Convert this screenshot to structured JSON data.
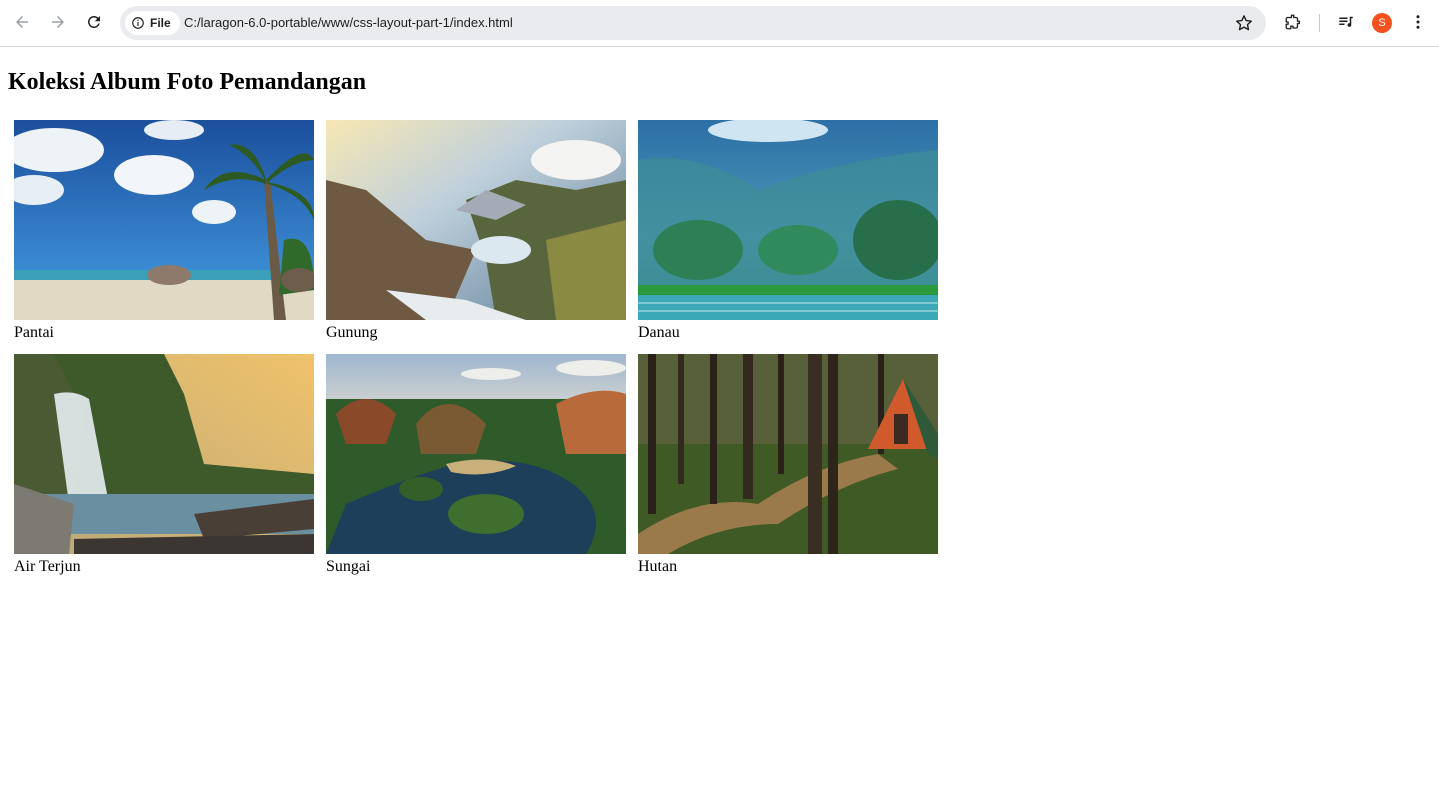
{
  "browser": {
    "security_chip": "File",
    "url": "C:/laragon-6.0-portable/www/css-layout-part-1/index.html",
    "profile_initial": "S",
    "icons": [
      "back-icon",
      "forward-icon",
      "reload-icon",
      "info-icon",
      "star-icon",
      "extensions-icon",
      "media-control-icon",
      "menu-dots-icon"
    ]
  },
  "page": {
    "title": "Koleksi Album Foto Pemandangan",
    "gallery": [
      {
        "caption": "Pantai"
      },
      {
        "caption": "Gunung"
      },
      {
        "caption": "Danau"
      },
      {
        "caption": "Air Terjun"
      },
      {
        "caption": "Sungai"
      },
      {
        "caption": "Hutan"
      }
    ]
  }
}
